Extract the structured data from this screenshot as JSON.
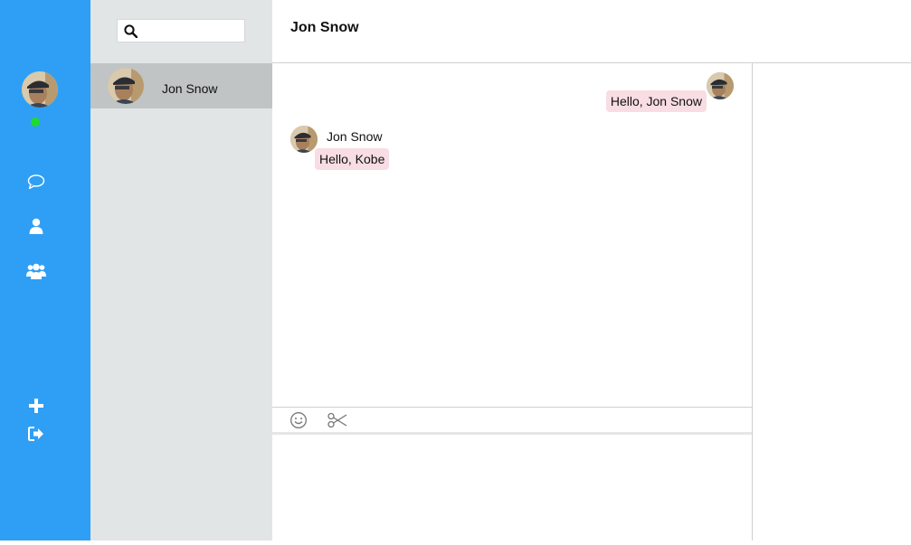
{
  "rail": {
    "current_user_avatar": "user-avatar-photo",
    "status": "online",
    "status_color": "#1fdc2a",
    "accent_color": "#2f9ff5",
    "nav": [
      {
        "icon": "chat-bubble-icon"
      },
      {
        "icon": "user-icon"
      },
      {
        "icon": "group-icon"
      }
    ],
    "bottom": [
      {
        "icon": "plus-icon"
      },
      {
        "icon": "logout-icon"
      }
    ]
  },
  "search": {
    "placeholder": "",
    "value": ""
  },
  "contacts": [
    {
      "name": "Jon Snow",
      "selected": true
    }
  ],
  "chat": {
    "title": "Jon Snow",
    "messages": [
      {
        "from": "me",
        "text": "Hello, Jon Snow"
      },
      {
        "from": "Jon Snow",
        "sender_name": "Jon Snow",
        "text": "Hello, Kobe"
      }
    ],
    "bubble_color": "#f8dde4"
  },
  "composer": {
    "tools": [
      {
        "icon": "emoji-icon"
      },
      {
        "icon": "scissors-icon"
      }
    ],
    "value": ""
  }
}
